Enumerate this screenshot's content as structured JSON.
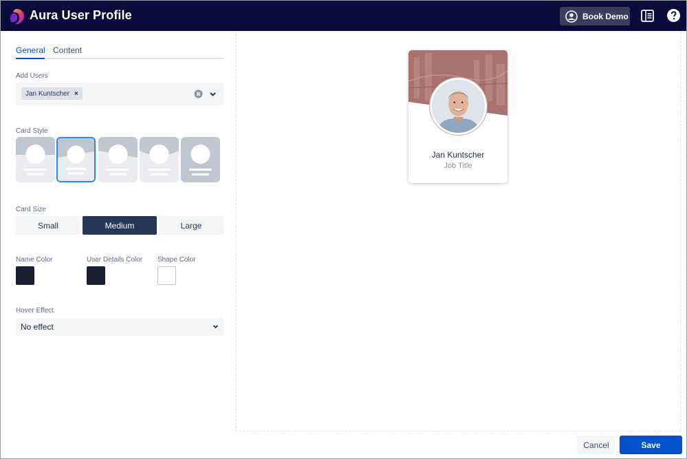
{
  "app": {
    "title": "Aura User Profile",
    "book_demo": "Book Demo"
  },
  "tabs": [
    {
      "label": "General",
      "active": true
    },
    {
      "label": "Content",
      "active": false
    }
  ],
  "add_users": {
    "label": "Add Users",
    "chips": [
      "Jan Kuntscher"
    ]
  },
  "card_style": {
    "label": "Card Style",
    "selected_index": 1,
    "option_count": 5
  },
  "card_size": {
    "label": "Card Size",
    "options": [
      "Small",
      "Medium",
      "Large"
    ],
    "selected": "Medium"
  },
  "colors": {
    "name": {
      "label": "Name Color",
      "value": "#172033"
    },
    "user_details": {
      "label": "User Details Color",
      "value": "#172033"
    },
    "shape": {
      "label": "Shape Color",
      "value": "#ffffff"
    }
  },
  "hover_effect": {
    "label": "Hover Effect",
    "value": "No effect"
  },
  "preview_card": {
    "name": "Jan Kuntscher",
    "job_title": "Job Title",
    "header_color": "#a9726c"
  },
  "footer": {
    "cancel": "Cancel",
    "save": "Save"
  },
  "accent": {
    "primary": "#0052cc",
    "topbar": "#0a0b3b",
    "selected_size": "#253858"
  }
}
